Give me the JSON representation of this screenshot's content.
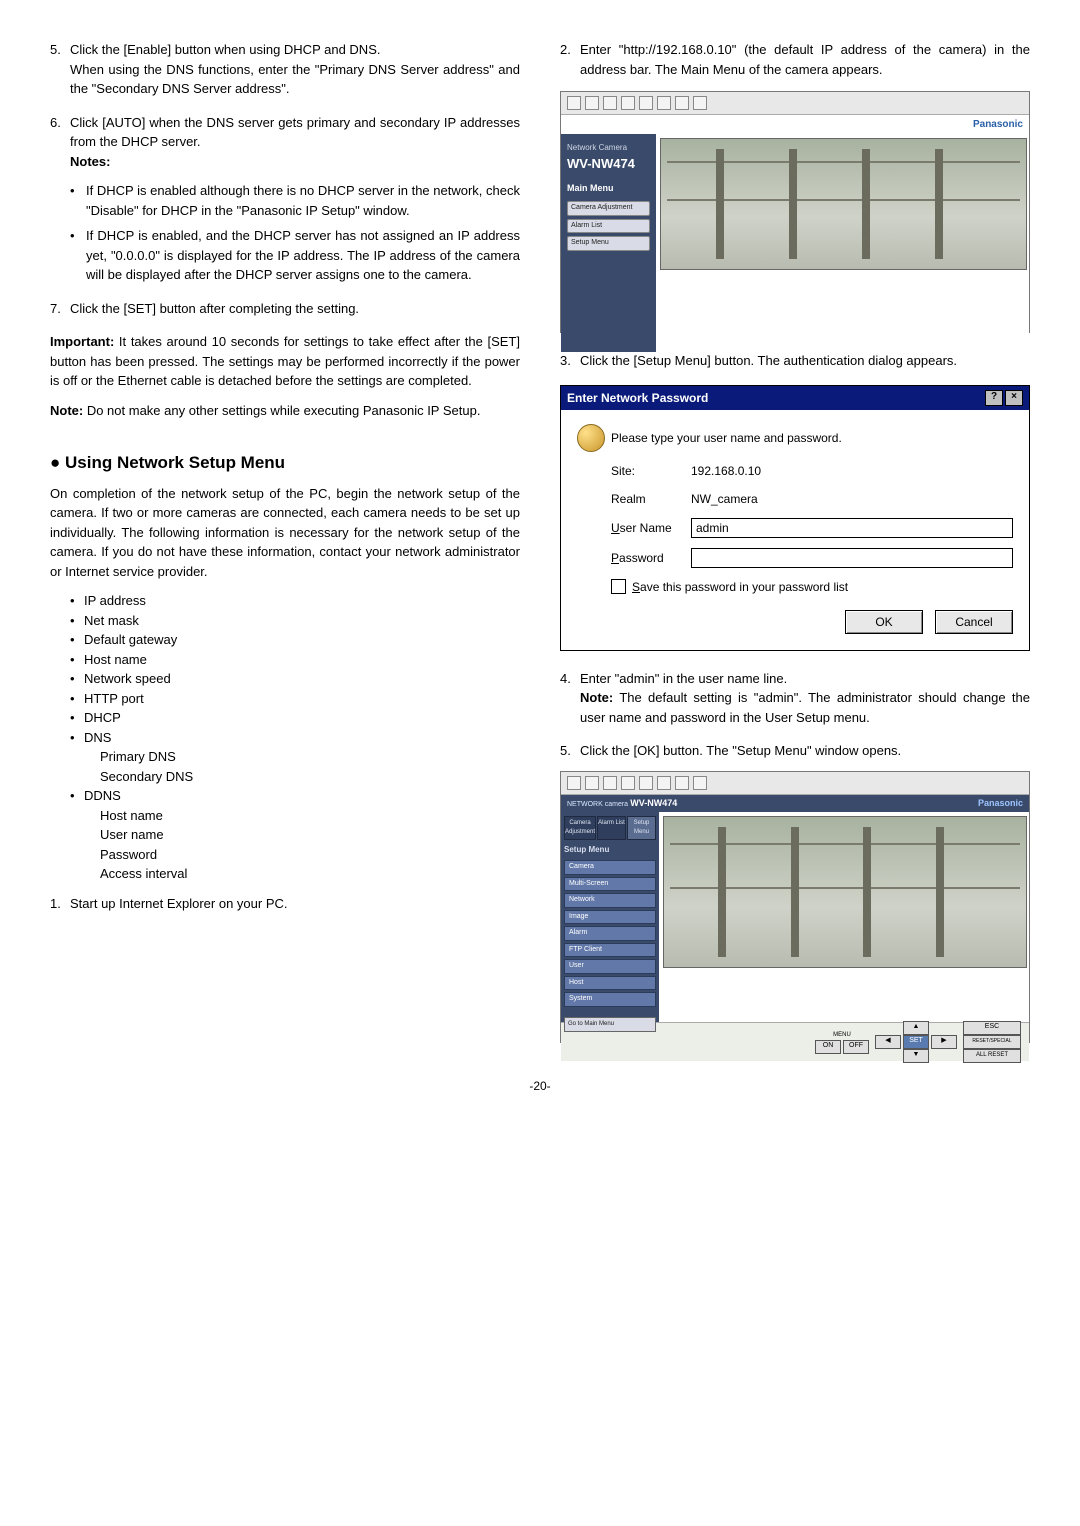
{
  "left": {
    "step5_a": "Click the [Enable] button when using DHCP and DNS.",
    "step5_b": "When using the DNS functions, enter the \"Primary DNS Server address\" and the \"Secondary DNS Server address\".",
    "step6": "Click [AUTO] when the DNS server gets primary and secondary IP addresses from the DHCP server.",
    "notes_label": "Notes:",
    "note1": "If DHCP is enabled although there is no DHCP server in the network, check \"Disable\" for DHCP in the \"Panasonic IP Setup\" window.",
    "note2": "If DHCP is enabled, and the DHCP server has not assigned an IP address yet, \"0.0.0.0\" is displayed for the IP address. The IP address of the camera will be displayed after the DHCP server assigns one to the camera.",
    "step7": "Click the [SET] button after completing the setting.",
    "important_label": "Important:",
    "important_text": " It takes around 10 seconds for settings to take effect after the [SET] button has been pressed. The settings may be performed incorrectly if the power is off or the Ethernet cable is detached before the settings are completed.",
    "note_label": "Note:",
    "note_text": " Do not make any other settings while executing Panasonic IP Setup.",
    "section_title": "● Using Network Setup Menu",
    "section_para": "On completion of the network setup of the PC, begin the network setup of the camera. If two or more cameras are connected, each camera needs to be set up individually. The following information is necessary for the network setup of the camera. If you do not have these information, contact your network administrator or Internet service provider.",
    "bullets": [
      "IP address",
      "Net mask",
      "Default gateway",
      "Host name",
      "Network speed",
      "HTTP port",
      "DHCP",
      "DNS"
    ],
    "dns_sub": [
      "Primary DNS",
      "Secondary DNS"
    ],
    "ddns": "DDNS",
    "ddns_sub": [
      "Host name",
      "User name",
      "Password",
      "Access interval"
    ],
    "step1": "Start up Internet Explorer on your PC."
  },
  "right": {
    "step2": "Enter \"http://192.168.0.10\" (the default IP address of the camera) in the address bar. The Main Menu of the camera appears.",
    "step3": "Click the [Setup Menu] button. The authentication dialog appears.",
    "step4": "Enter \"admin\" in the user name line.",
    "step4_note_label": "Note:",
    "step4_note": " The default setting is \"admin\". The administrator should change the user name and password in the User Setup menu.",
    "step5": "Click the [OK] button. The \"Setup Menu\" window opens."
  },
  "shot1": {
    "brand": "Panasonic",
    "nc": "Network Camera",
    "model": "WV-NW474",
    "menu_title": "Main Menu",
    "items": [
      "Camera Adjustment",
      "Alarm List",
      "Setup Menu"
    ]
  },
  "dialog": {
    "title": "Enter Network Password",
    "prompt": "Please type your user name and password.",
    "site_lbl": "Site:",
    "site_val": "192.168.0.10",
    "realm_lbl": "Realm",
    "realm_val": "NW_camera",
    "user_lbl": "User Name",
    "user_val": "admin",
    "pass_lbl": "Password",
    "pass_val": "",
    "save_lbl": "Save this password in your password list",
    "ok": "OK",
    "cancel": "Cancel"
  },
  "shot2": {
    "brand": "Panasonic",
    "logo": "NETWORK camera",
    "model": "WV-NW474",
    "tabs": [
      "Camera Adjustment",
      "Alarm List",
      "Setup Menu"
    ],
    "menu_title": "Setup Menu",
    "items": [
      "Camera",
      "Multi-Screen",
      "Network",
      "Image",
      "Alarm",
      "FTP Client",
      "User",
      "Host",
      "System"
    ],
    "go_main": "Go to Main Menu",
    "menu_btn_on": "ON",
    "menu_btn_off": "OFF",
    "menu_lbl": "MENU",
    "set": "SET",
    "esc": "ESC",
    "reset": "RESET/SPECIAL",
    "allreset": "ALL RESET"
  },
  "page": "-20-"
}
